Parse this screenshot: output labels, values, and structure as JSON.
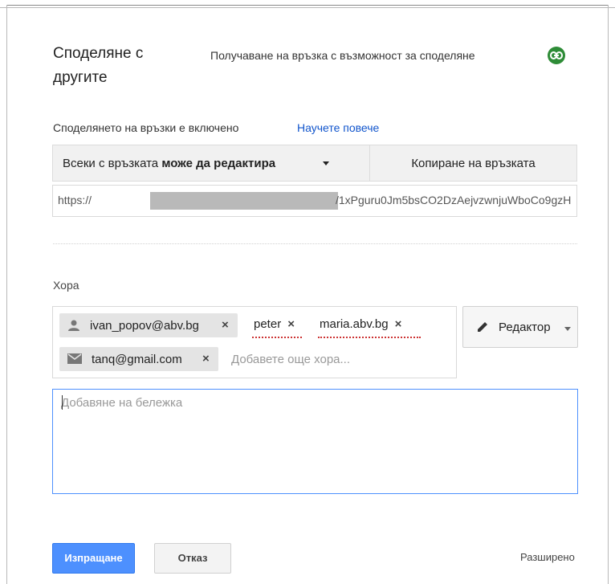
{
  "dialog": {
    "title": "Споделяне с другите",
    "get_link_label": "Получаване на връзка с възможност за споделяне",
    "link_sharing_status": "Споделянето на връзки е включено",
    "learn_more": "Научете повече"
  },
  "link": {
    "access_prefix": "Всеки с връзката",
    "access_level": "може да редактира",
    "copy_label": "Копиране на връзката",
    "url_prefix": "https://",
    "url_suffix": "/1xPguru0Jm5bsCO2DzAejvzwnjuWboCo9gzH"
  },
  "people": {
    "label": "Хора",
    "chips": [
      {
        "text": "ivan_popov@abv.bg",
        "icon": "person-icon"
      },
      {
        "text": "tanq@gmail.com",
        "icon": "email-icon"
      }
    ],
    "plain": [
      {
        "text": "peter"
      },
      {
        "text": "maria.abv.bg"
      }
    ],
    "add_placeholder": "Добавете още хора...",
    "remove_symbol": "×",
    "role": "Редактор"
  },
  "note": {
    "placeholder": "Добавяне на бележка"
  },
  "footer": {
    "send": "Изпращане",
    "cancel": "Отказ",
    "advanced": "Разширено"
  },
  "colors": {
    "primary": "#4d90fe",
    "link": "#1155cc",
    "link_icon_bg": "#2e8c37",
    "spell_error": "#cc3333"
  }
}
